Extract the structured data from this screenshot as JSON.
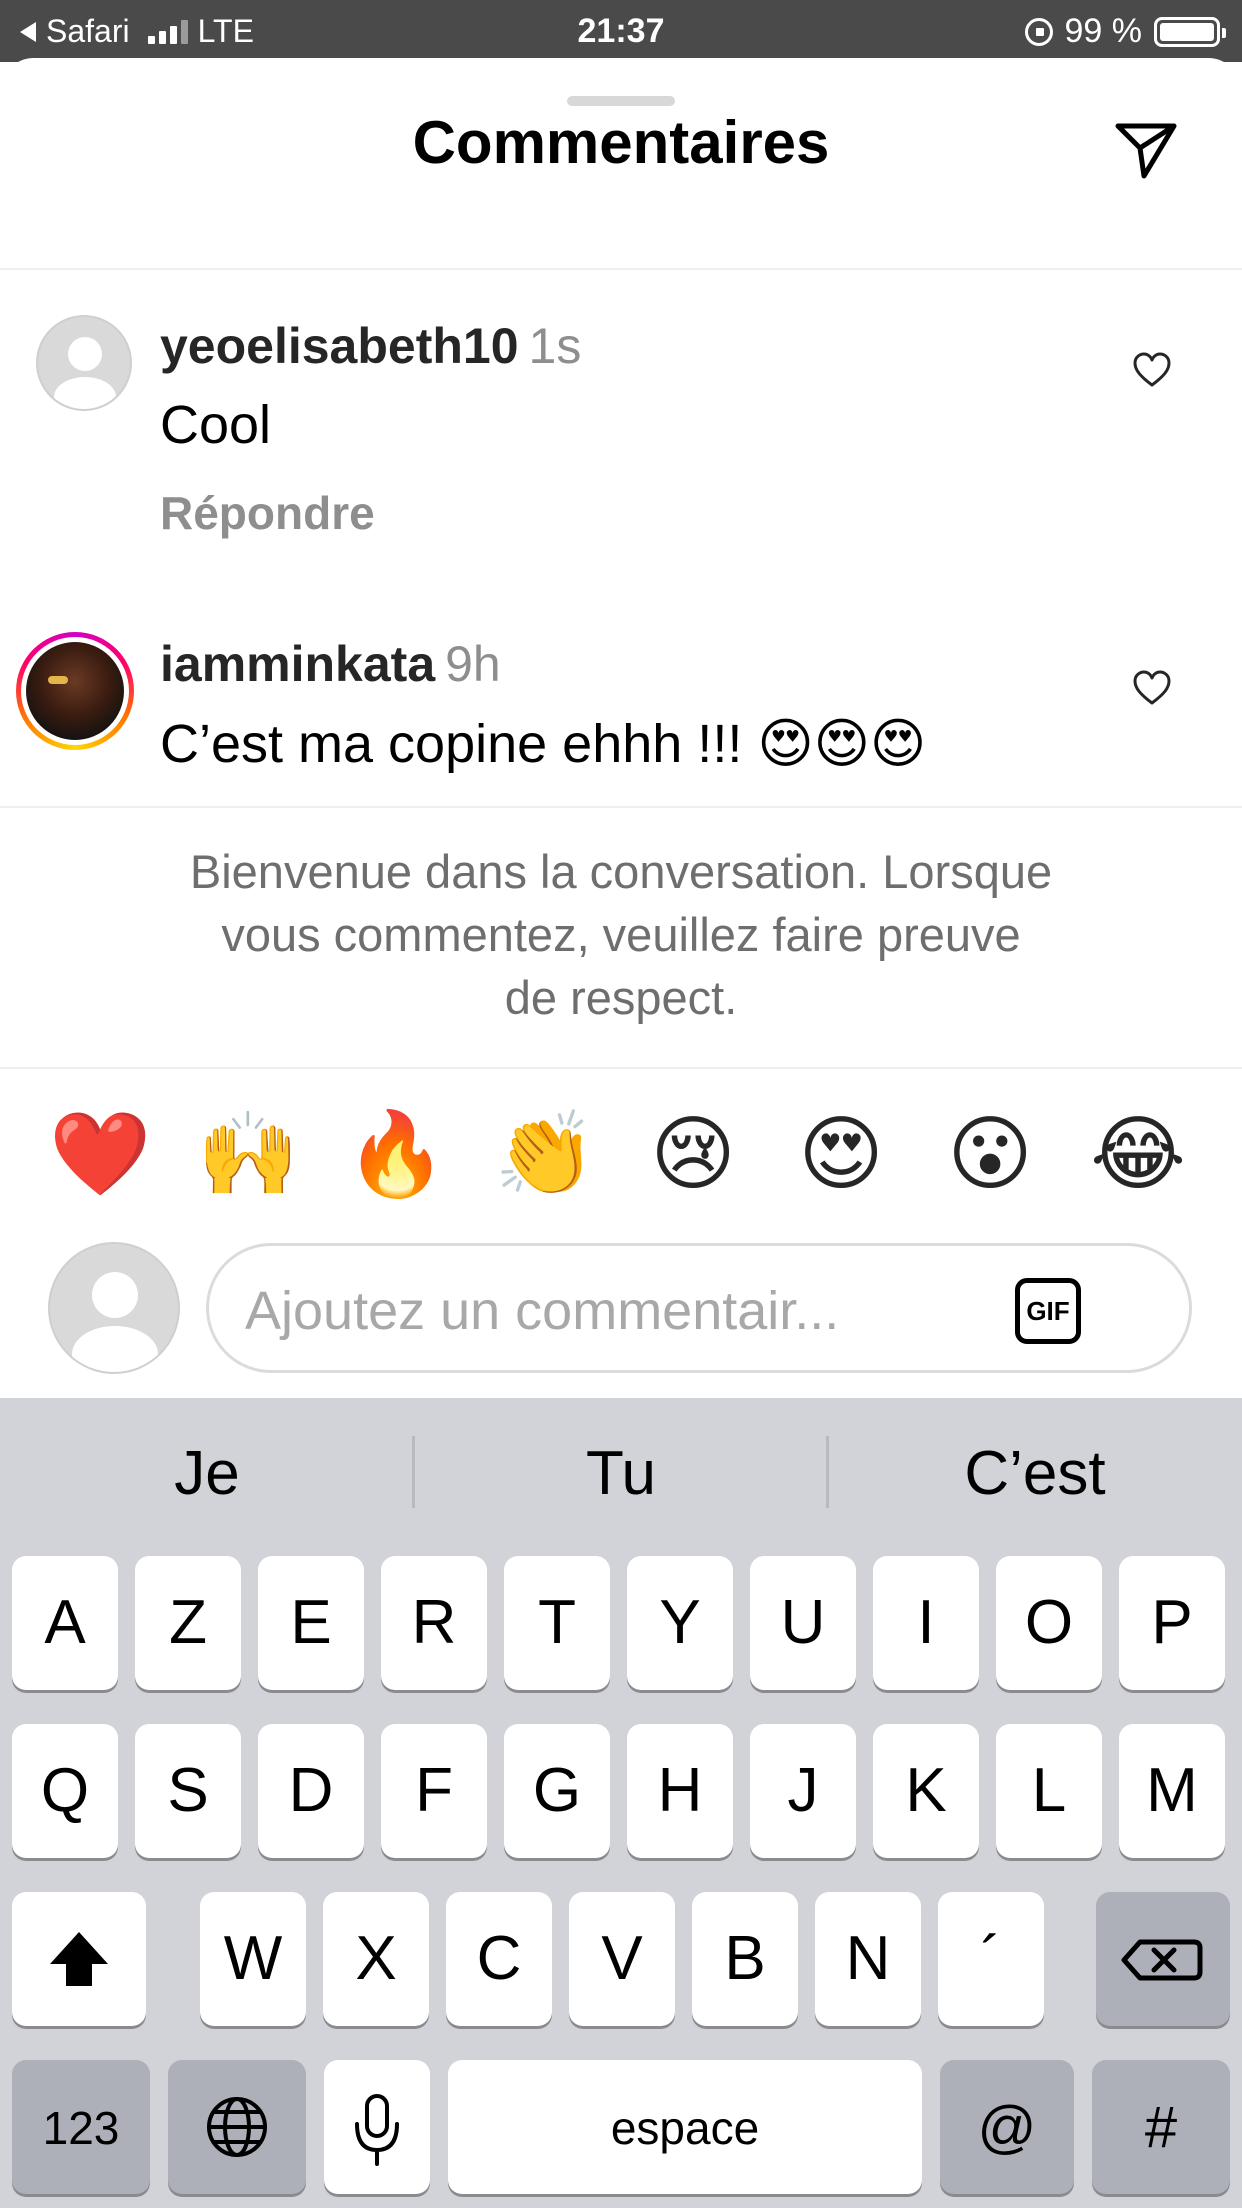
{
  "status_bar": {
    "back_app": "Safari",
    "network": "LTE",
    "time": "21:37",
    "battery": "99 %"
  },
  "sheet": {
    "title": "Commentaires",
    "send_icon": "send-paper-plane-icon"
  },
  "comments": [
    {
      "username": "yeoelisabeth10",
      "time": "1s",
      "text": "Cool",
      "reply_label": "Répondre",
      "avatar": "default-avatar"
    },
    {
      "username": "iamminkata",
      "time": "9h",
      "text": "C’est ma copine ehhh !!! 😍😍😍",
      "avatar": "story-ring-avatar"
    }
  ],
  "welcome": {
    "line1": "Bienvenue dans la conversation. Lorsque",
    "line2": "vous commentez, veuillez faire preuve",
    "line3": "de respect."
  },
  "quick_reactions": [
    "❤️",
    "🙌",
    "🔥",
    "👏",
    "😢",
    "😍",
    "😮",
    "😂"
  ],
  "comment_input": {
    "placeholder": "Ajoutez un commentair...",
    "gif_label": "GIF"
  },
  "keyboard": {
    "suggestions": [
      "Je",
      "Tu",
      "C’est"
    ],
    "row1": [
      "A",
      "Z",
      "E",
      "R",
      "T",
      "Y",
      "U",
      "I",
      "O",
      "P"
    ],
    "row2": [
      "Q",
      "S",
      "D",
      "F",
      "G",
      "H",
      "J",
      "K",
      "L",
      "M"
    ],
    "row3": [
      "W",
      "X",
      "C",
      "V",
      "B",
      "N",
      "´"
    ],
    "numbers_key": "123",
    "space_key": "espace",
    "at_key": "@",
    "hash_key": "#"
  }
}
